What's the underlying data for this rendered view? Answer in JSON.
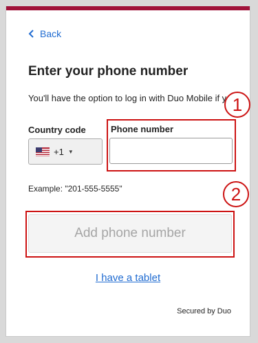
{
  "nav": {
    "back_label": "Back"
  },
  "heading": "Enter your phone number",
  "subtitle": "You'll have the option to log in with Duo Mobile if you have it.",
  "country": {
    "label": "Country code",
    "selected": "+1",
    "flag": "us-flag-icon"
  },
  "phone": {
    "label": "Phone number",
    "value": "",
    "placeholder": ""
  },
  "example": "Example: \"201-555-5555\"",
  "add_button_label": "Add phone number",
  "tablet_link": "I have a tablet",
  "footer": "Secured by Duo",
  "callouts": [
    "1",
    "2"
  ],
  "colors": {
    "accent_bar": "#a0133a",
    "link": "#1f6bd1",
    "annotation": "#cc1111"
  }
}
